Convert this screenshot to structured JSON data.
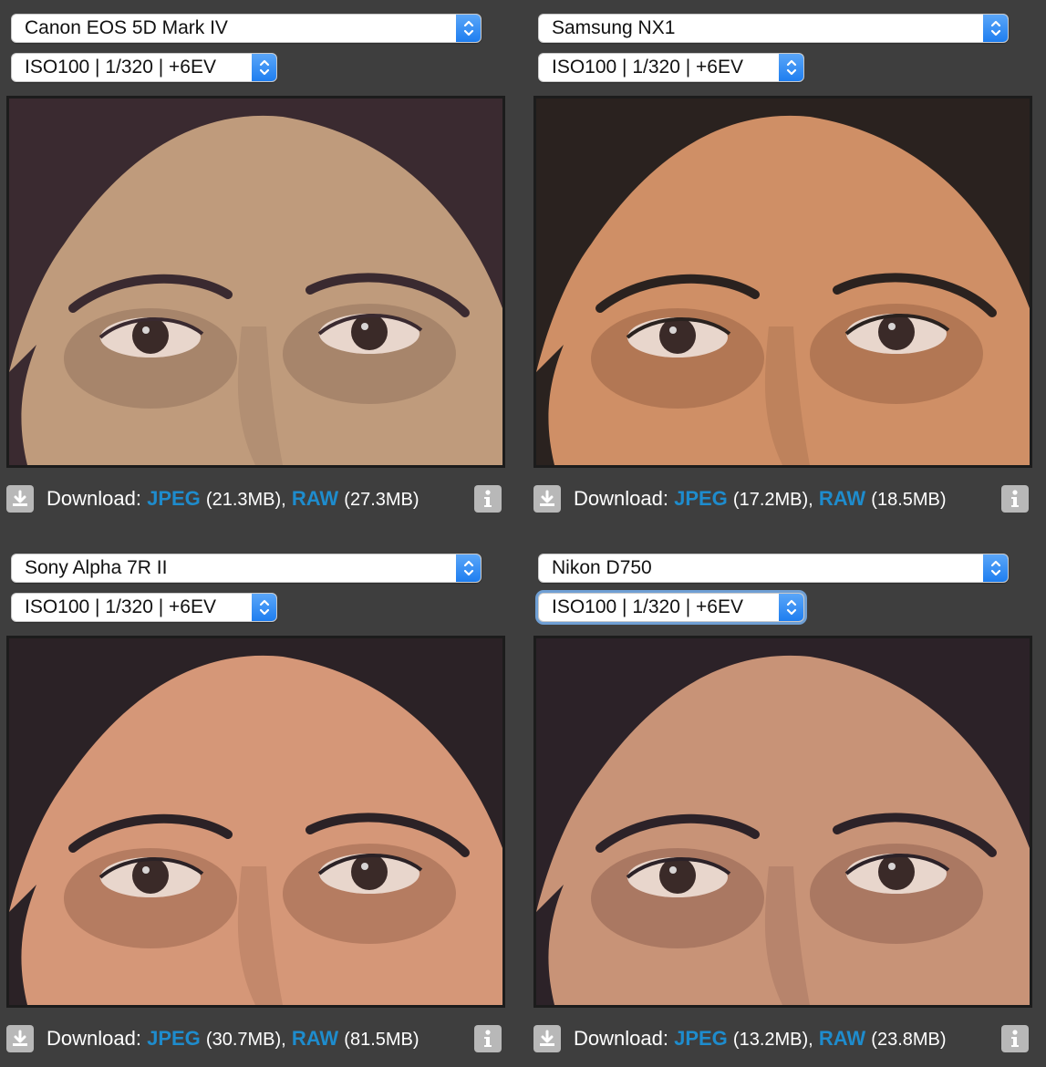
{
  "panels": [
    {
      "camera": "Canon EOS 5D Mark IV",
      "setting": "ISO100 | 1/320 | +6EV",
      "download_label": "Download:",
      "jpeg_label": "JPEG",
      "jpeg_size": "(21.3MB),",
      "raw_label": "RAW",
      "raw_size": "(27.3MB)",
      "tone": {
        "skin": "#bf9b7c",
        "shadow": "#8a6a56",
        "hair": "#3a2a30"
      }
    },
    {
      "camera": "Samsung NX1",
      "setting": "ISO100 | 1/320 | +6EV",
      "download_label": "Download:",
      "jpeg_label": "JPEG",
      "jpeg_size": "(17.2MB),",
      "raw_label": "RAW",
      "raw_size": "(18.5MB)",
      "tone": {
        "skin": "#cf8f66",
        "shadow": "#8d5a3e",
        "hair": "#2a221f"
      }
    },
    {
      "camera": "Sony Alpha 7R II",
      "setting": "ISO100 | 1/320 | +6EV",
      "download_label": "Download:",
      "jpeg_label": "JPEG",
      "jpeg_size": "(30.7MB),",
      "raw_label": "RAW",
      "raw_size": "(81.5MB)",
      "tone": {
        "skin": "#d59778",
        "shadow": "#8f5c44",
        "hair": "#2b2226"
      }
    },
    {
      "camera": "Nikon D750",
      "setting": "ISO100 | 1/320 | +6EV",
      "download_label": "Download:",
      "jpeg_label": "JPEG",
      "jpeg_size": "(13.2MB),",
      "raw_label": "RAW",
      "raw_size": "(23.8MB)",
      "tone": {
        "skin": "#c89377",
        "shadow": "#85584a",
        "hair": "#2c2228"
      }
    }
  ],
  "colors": {
    "background": "#3e3e3e",
    "link": "#1e8ccd",
    "stepper": "#2a86f2",
    "icon_button": "#b8b8b8"
  },
  "icons": {
    "stepper": "chevron-up-down-icon",
    "download": "download-arrow-icon",
    "info": "info-icon"
  }
}
